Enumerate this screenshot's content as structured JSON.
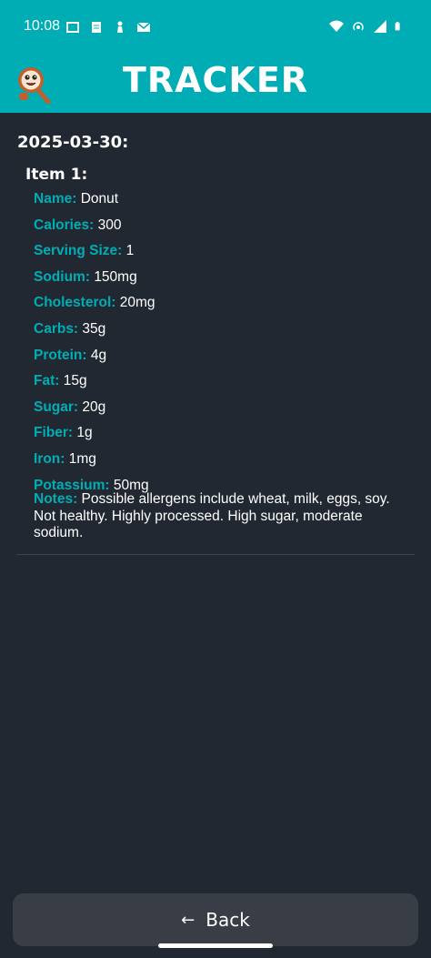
{
  "status_bar": {
    "time": "10:08"
  },
  "app": {
    "title": "TRACKER"
  },
  "entry": {
    "date": "2025-03-30:",
    "item_heading": "Item 1:",
    "fields": [
      {
        "label": "Name:",
        "value": "Donut"
      },
      {
        "label": "Calories:",
        "value": "300"
      },
      {
        "label": "Serving Size:",
        "value": "1"
      },
      {
        "label": "Sodium:",
        "value": "150mg"
      },
      {
        "label": "Cholesterol:",
        "value": "20mg"
      },
      {
        "label": "Carbs:",
        "value": "35g"
      },
      {
        "label": "Protein:",
        "value": "4g"
      },
      {
        "label": "Fat:",
        "value": "15g"
      },
      {
        "label": "Sugar:",
        "value": "20g"
      },
      {
        "label": "Fiber:",
        "value": "1g"
      },
      {
        "label": "Iron:",
        "value": "1mg"
      },
      {
        "label": "Potassium:",
        "value": "50mg"
      }
    ],
    "notes": {
      "label": "Notes:",
      "value": "Possible allergens include wheat, milk, eggs, soy. Not healthy. Highly processed. High sugar, moderate sodium."
    }
  },
  "back_button": {
    "label": "Back",
    "icon": "arrow-left-icon"
  },
  "colors": {
    "accent": "#00adb5",
    "background": "#222831",
    "button": "#393e46"
  }
}
